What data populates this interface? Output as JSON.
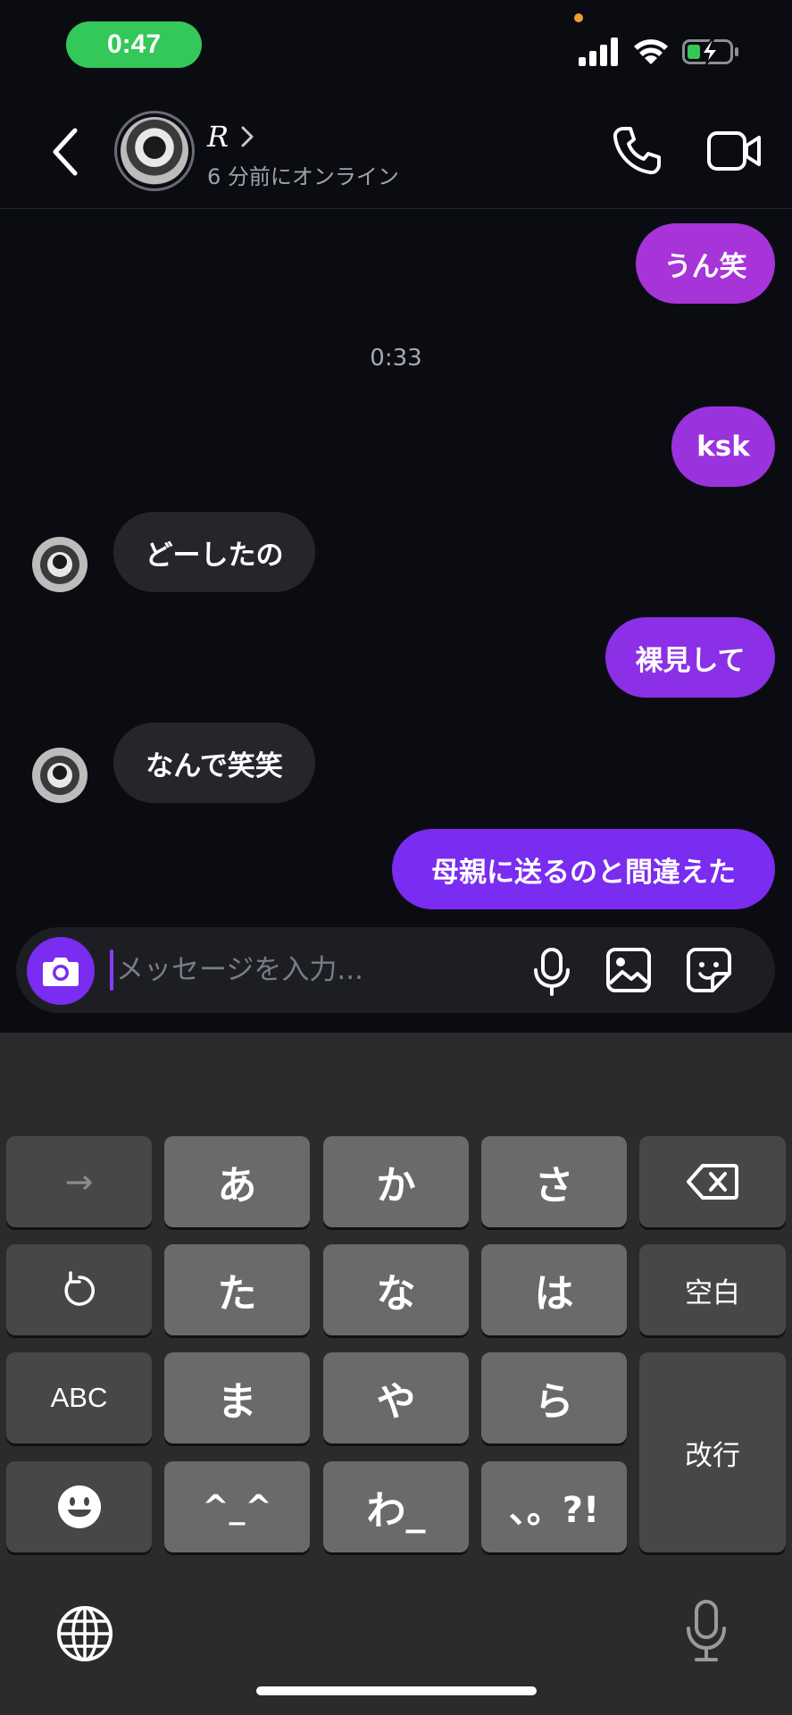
{
  "status_bar": {
    "time": "0:47"
  },
  "header": {
    "contact_name": "R",
    "contact_status": "6 分前にオンライン"
  },
  "messages": [
    {
      "sender": "me",
      "text": "うん笑"
    },
    {
      "timestamp": "0:33"
    },
    {
      "sender": "me",
      "text": "ksk"
    },
    {
      "sender": "them",
      "text": "どーしたの"
    },
    {
      "sender": "me",
      "text": "裸見して"
    },
    {
      "sender": "them",
      "text": "なんで笑笑"
    },
    {
      "sender": "me",
      "text": "母親に送るのと間違えた"
    }
  ],
  "composer": {
    "placeholder": "メッセージを入力..."
  },
  "keyboard": {
    "keys": {
      "arrow": "→",
      "a": "あ",
      "ka": "か",
      "sa": "さ",
      "ta": "た",
      "na": "な",
      "ha": "は",
      "space": "空白",
      "abc": "ABC",
      "ma": "ま",
      "ya": "や",
      "ra": "ら",
      "return": "改行",
      "kaomoji": "^_^",
      "wa": "わ_",
      "punct": "、。?!"
    }
  },
  "colors": {
    "background": "#0b0c12",
    "sent_bubble_top": "#a634d8",
    "sent_bubble_bottom": "#7a2cf0",
    "received_bubble": "#25262c",
    "accent": "#7a2cf0",
    "time_pill": "#34c759"
  },
  "icons": [
    "signal-icon",
    "wifi-icon",
    "battery-charging-icon",
    "back-icon",
    "chevron-right-icon",
    "phone-icon",
    "video-camera-icon",
    "camera-icon",
    "microphone-icon",
    "image-icon",
    "sticker-icon",
    "undo-icon",
    "delete-icon",
    "emoji-icon",
    "globe-icon",
    "dictation-icon"
  ]
}
